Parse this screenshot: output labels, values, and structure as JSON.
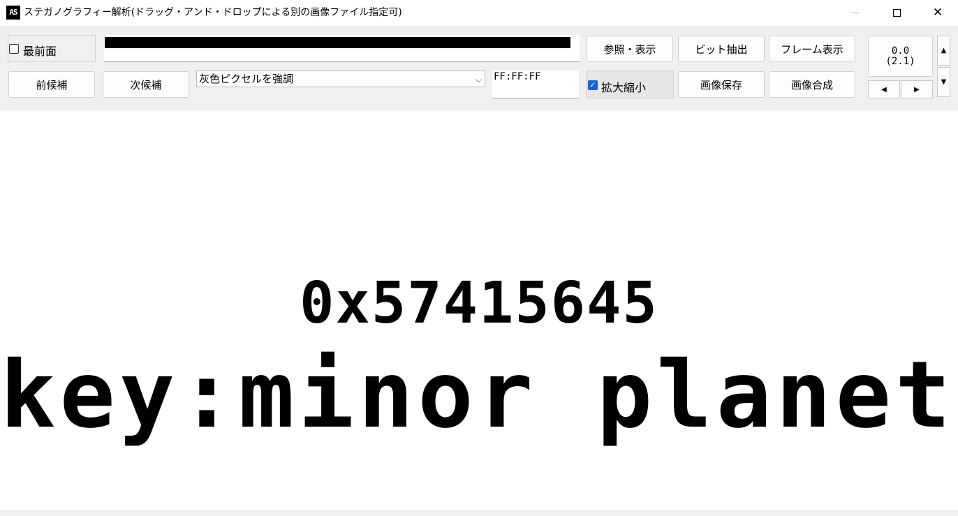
{
  "window": {
    "app_icon": "AS",
    "title": "ステガノグラフィー解析(ドラッグ・アンド・ドロップによる別の画像ファイル指定可)",
    "minimize_glyph": "—",
    "maximize_glyph": "☐",
    "close_glyph": "✕"
  },
  "toolbar": {
    "topmost_label": "最前面",
    "topmost_checked": false,
    "progress": 0.98,
    "browse_button": "参照・表示",
    "bit_extract_button": "ビット抽出",
    "frame_button": "フレーム表示",
    "prev_button": "前候補",
    "next_button": "次候補",
    "mode_select": {
      "value": "灰色ピクセルを強調"
    },
    "color_value": "FF:FF:FF",
    "zoom_label": "拡大縮小",
    "zoom_checked": true,
    "save_button": "画像保存",
    "compose_button": "画像合成",
    "value_line1": "0.0",
    "value_line2": "(2.1)",
    "scroll_up_glyph": "▲",
    "scroll_down_glyph": "▼",
    "left_glyph": "◀",
    "right_glyph": "▶"
  },
  "canvas": {
    "line1": "0x57415645",
    "line2": "key:minor planets"
  },
  "colors": {
    "toolbar_bg": "#f0f0f0",
    "checkbox_checked": "#1a64c8",
    "canvas_bg": "#ffffff",
    "text": "#000000"
  }
}
